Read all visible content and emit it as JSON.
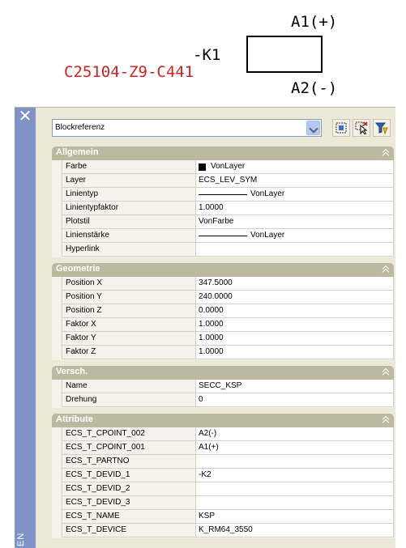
{
  "drawing": {
    "terminal_top": "A1(+)",
    "device_tag": "-K1",
    "part_number": "C25104-Z9-C441",
    "terminal_bottom": "A2(-)"
  },
  "palette": {
    "title": "EN",
    "selection": "Blockreferenz",
    "sections": {
      "general": {
        "title": "Allgemein",
        "rows": [
          {
            "name": "Farbe",
            "value": "VonLayer"
          },
          {
            "name": "Layer",
            "value": "ECS_LEV_SYM"
          },
          {
            "name": "Linientyp",
            "value": "VonLayer"
          },
          {
            "name": "Linientypfaktor",
            "value": "1.0000"
          },
          {
            "name": "Plotstil",
            "value": "VonFarbe"
          },
          {
            "name": "Linienstärke",
            "value": "VonLayer"
          },
          {
            "name": "Hyperlink",
            "value": ""
          }
        ]
      },
      "geometry": {
        "title": "Geometrie",
        "rows": [
          {
            "name": "Position X",
            "value": "347.5000"
          },
          {
            "name": "Position Y",
            "value": "240.0000"
          },
          {
            "name": "Position Z",
            "value": "0.0000"
          },
          {
            "name": "Faktor X",
            "value": "1.0000"
          },
          {
            "name": "Faktor Y",
            "value": "1.0000"
          },
          {
            "name": "Faktor Z",
            "value": "1.0000"
          }
        ]
      },
      "misc": {
        "title": "Versch.",
        "rows": [
          {
            "name": "Name",
            "value": "SECC_KSP"
          },
          {
            "name": "Drehung",
            "value": "0"
          }
        ]
      },
      "attributes": {
        "title": "Attribute",
        "rows": [
          {
            "name": "ECS_T_CPOINT_002",
            "value": "A2(-)"
          },
          {
            "name": "ECS_T_CPOINT_001",
            "value": "A1(+)"
          },
          {
            "name": "ECS_T_PARTNO",
            "value": ""
          },
          {
            "name": "ECS_T_DEVID_1",
            "value": "-K2"
          },
          {
            "name": "ECS_T_DEVID_2",
            "value": ""
          },
          {
            "name": "ECS_T_DEVID_3",
            "value": ""
          },
          {
            "name": "ECS_T_NAME",
            "value": "KSP"
          },
          {
            "name": "ECS_T_DEVICE",
            "value": "K_RM64_3550"
          }
        ]
      }
    }
  },
  "colors": {
    "part_number": "#cc2222",
    "side_strip": "#7f93c9",
    "section_header": "#bdb8a0"
  },
  "icons": {
    "combo": "chevron-down-icon",
    "toolbar": [
      "quick-select-icon",
      "select-objects-icon",
      "toggle-pickadd-icon"
    ],
    "section": "chevron-up-icon",
    "close": "close-icon"
  }
}
